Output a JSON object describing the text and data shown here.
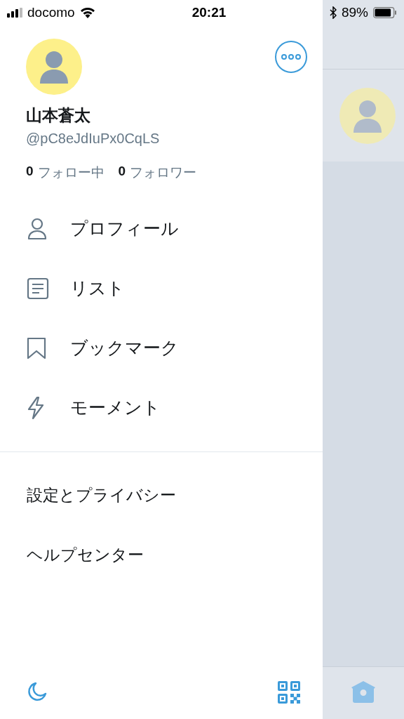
{
  "status_bar": {
    "carrier": "docomo",
    "time": "20:21",
    "battery_percent": "89%"
  },
  "profile": {
    "name": "山本蒼太",
    "handle": "@pC8eJdIuPx0CqLS",
    "following_count": "0",
    "following_label": "フォロー中",
    "followers_count": "0",
    "followers_label": "フォロワー"
  },
  "menu": [
    {
      "kind": "profile",
      "label": "プロフィール"
    },
    {
      "kind": "list",
      "label": "リスト"
    },
    {
      "kind": "bookmark",
      "label": "ブックマーク"
    },
    {
      "kind": "moment",
      "label": "モーメント"
    }
  ],
  "settings": [
    {
      "label": "設定とプライバシー"
    },
    {
      "label": "ヘルプセンター"
    }
  ]
}
